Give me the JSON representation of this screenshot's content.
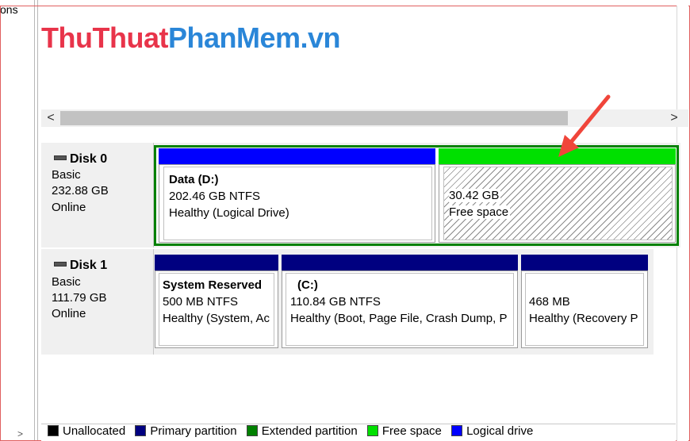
{
  "left_strip": {
    "text": "ons",
    "expander": ">"
  },
  "watermark": {
    "part_red": "ThuThuat",
    "part_blue": "PhanMem.vn"
  },
  "hscroll": {
    "left_arrow": "<",
    "right_arrow": ">"
  },
  "disks": [
    {
      "name": "Disk 0",
      "type": "Basic",
      "size": "232.88 GB",
      "status": "Online",
      "partitions": [
        {
          "title": "Data  (D:)",
          "line2": "202.46 GB NTFS",
          "line3": "Healthy (Logical Drive)",
          "bar_color": "#0000ff"
        },
        {
          "title": "",
          "line2": "30.42 GB",
          "line3": "Free space",
          "bar_color": "#00e000"
        }
      ]
    },
    {
      "name": "Disk 1",
      "type": "Basic",
      "size": "111.79 GB",
      "status": "Online",
      "partitions": [
        {
          "title": "System Reserved",
          "line2": "500 MB NTFS",
          "line3": "Healthy (System, Ac",
          "bar_color": "#000080"
        },
        {
          "title": "(C:)",
          "line2": "110.84 GB NTFS",
          "line3": "Healthy (Boot, Page File, Crash Dump, P",
          "bar_color": "#000080"
        },
        {
          "title": "",
          "line2": "468 MB",
          "line3": "Healthy (Recovery P",
          "bar_color": "#000080"
        }
      ]
    }
  ],
  "legend": [
    {
      "label": "Unallocated",
      "color": "#000000"
    },
    {
      "label": "Primary partition",
      "color": "#000080"
    },
    {
      "label": "Extended partition",
      "color": "#008000"
    },
    {
      "label": "Free space",
      "color": "#00e000"
    },
    {
      "label": "Logical drive",
      "color": "#0000ff"
    }
  ],
  "colors": {
    "frame_border": "#e06060",
    "annotation_arrow": "#f0453a"
  }
}
